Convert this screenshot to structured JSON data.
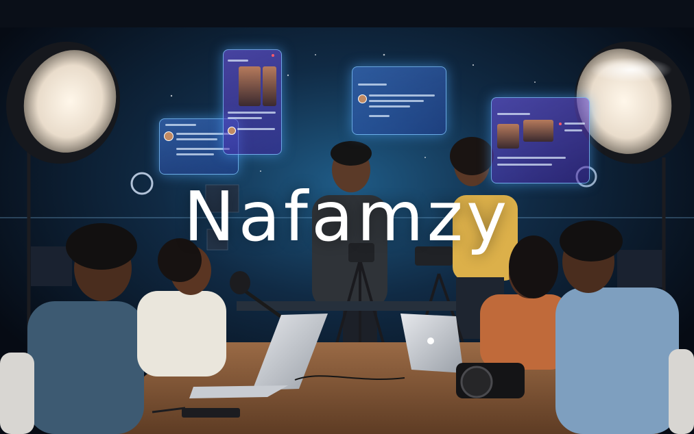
{
  "title": "Nafamzy",
  "colors": {
    "title": "#ffffff",
    "background": "#07101c",
    "panel_glow": "#5aa8ff"
  }
}
